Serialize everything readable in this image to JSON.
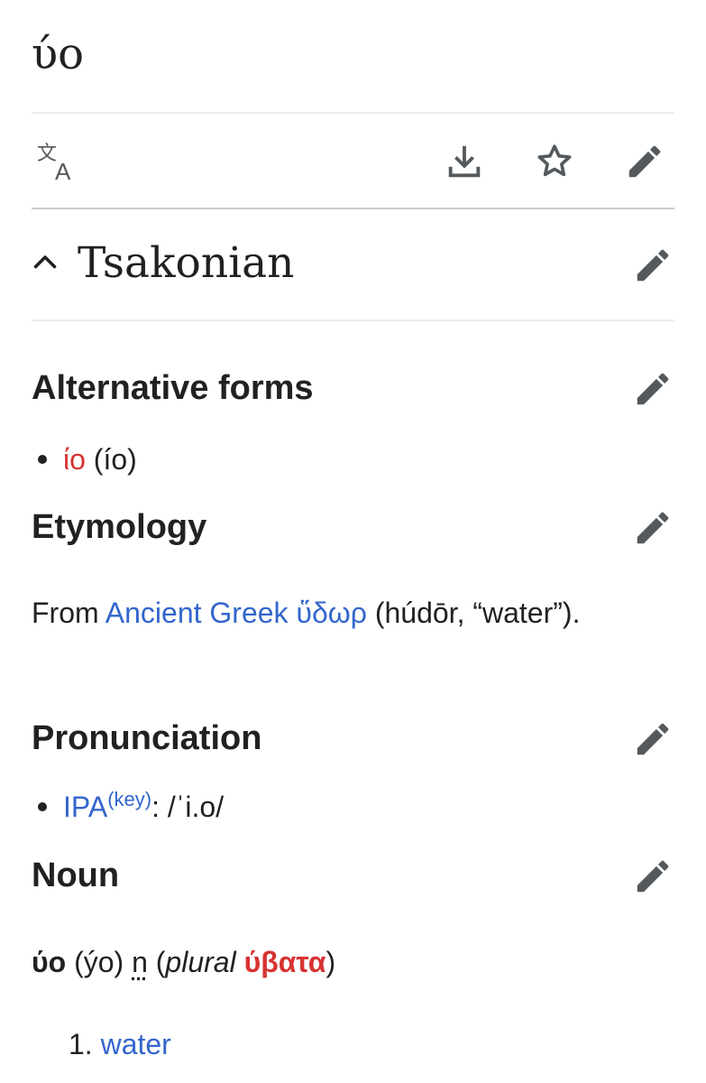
{
  "page": {
    "title": "ύο"
  },
  "toolbar": {
    "language_icon": "translate-icon",
    "download_icon": "download-icon",
    "watch_icon": "star-icon",
    "edit_icon": "pencil-icon"
  },
  "section": {
    "heading": "Tsakonian",
    "toggle_icon": "chevron-up-icon"
  },
  "alternative_forms": {
    "heading": "Alternative forms",
    "items": [
      {
        "link": "ίο",
        "translit": "(ío)"
      }
    ]
  },
  "etymology": {
    "heading": "Etymology",
    "prefix": "From ",
    "source_lang": "Ancient Greek",
    "space": " ",
    "source_word": "ὕδωρ",
    "gloss": " (húdōr, “water”)."
  },
  "pronunciation": {
    "heading": "Pronunciation",
    "ipa_label": "IPA",
    "key_label": "(key)",
    "ipa_value": ": /ˈi.o/"
  },
  "noun": {
    "heading": "Noun",
    "headword": "ύο",
    "translit": " (ýo) ",
    "gender": "n",
    "plural_open": " (",
    "plural_label": "plural",
    "plural_space": " ",
    "plural_form": "ύβατα",
    "plural_close": ")",
    "definitions": [
      {
        "number": "1.",
        "text": "water"
      }
    ]
  },
  "colors": {
    "link": "#3366cc",
    "red_link": "#d73333",
    "text": "#202122",
    "icon": "#54595d"
  }
}
